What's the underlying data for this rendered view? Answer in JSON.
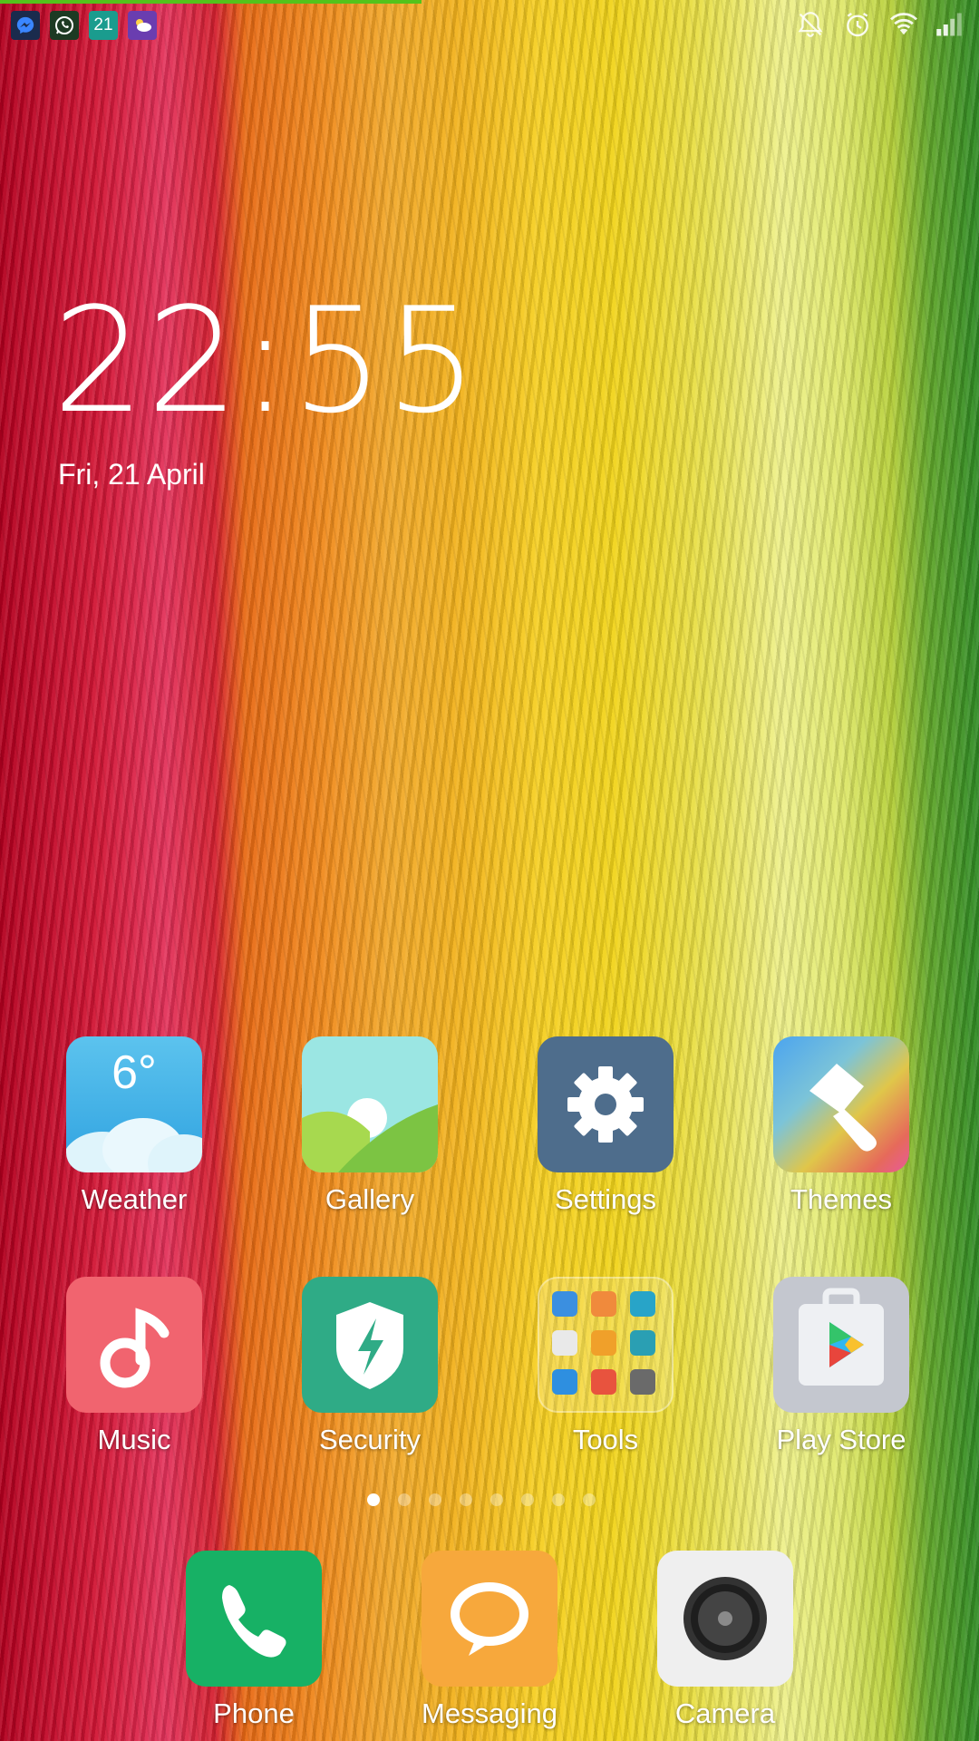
{
  "status_bar": {
    "notifications": [
      {
        "name": "messenger-icon"
      },
      {
        "name": "whatsapp-icon"
      },
      {
        "name": "calendar-icon",
        "text": "21"
      },
      {
        "name": "weather-notification-icon"
      }
    ],
    "system_icons": [
      "silent-icon",
      "alarm-icon",
      "wifi-icon",
      "signal-icon"
    ]
  },
  "clock": {
    "time": "22:55",
    "date": "Fri, 21 April"
  },
  "apps": {
    "weather": {
      "label": "Weather",
      "temp": "6°"
    },
    "gallery": {
      "label": "Gallery"
    },
    "settings": {
      "label": "Settings"
    },
    "themes": {
      "label": "Themes"
    },
    "music": {
      "label": "Music"
    },
    "security": {
      "label": "Security"
    },
    "tools": {
      "label": "Tools"
    },
    "play_store": {
      "label": "Play Store"
    }
  },
  "page_indicator": {
    "count": 8,
    "active": 1
  },
  "dock": {
    "phone": {
      "label": "Phone"
    },
    "messaging": {
      "label": "Messaging"
    },
    "camera": {
      "label": "Camera"
    }
  },
  "colors": {
    "progress": "#53c31b",
    "phone": "#17b165",
    "messaging": "#f7a83c",
    "music": "#f1646f",
    "security": "#2fab86",
    "settings": "#4e6d8c"
  }
}
